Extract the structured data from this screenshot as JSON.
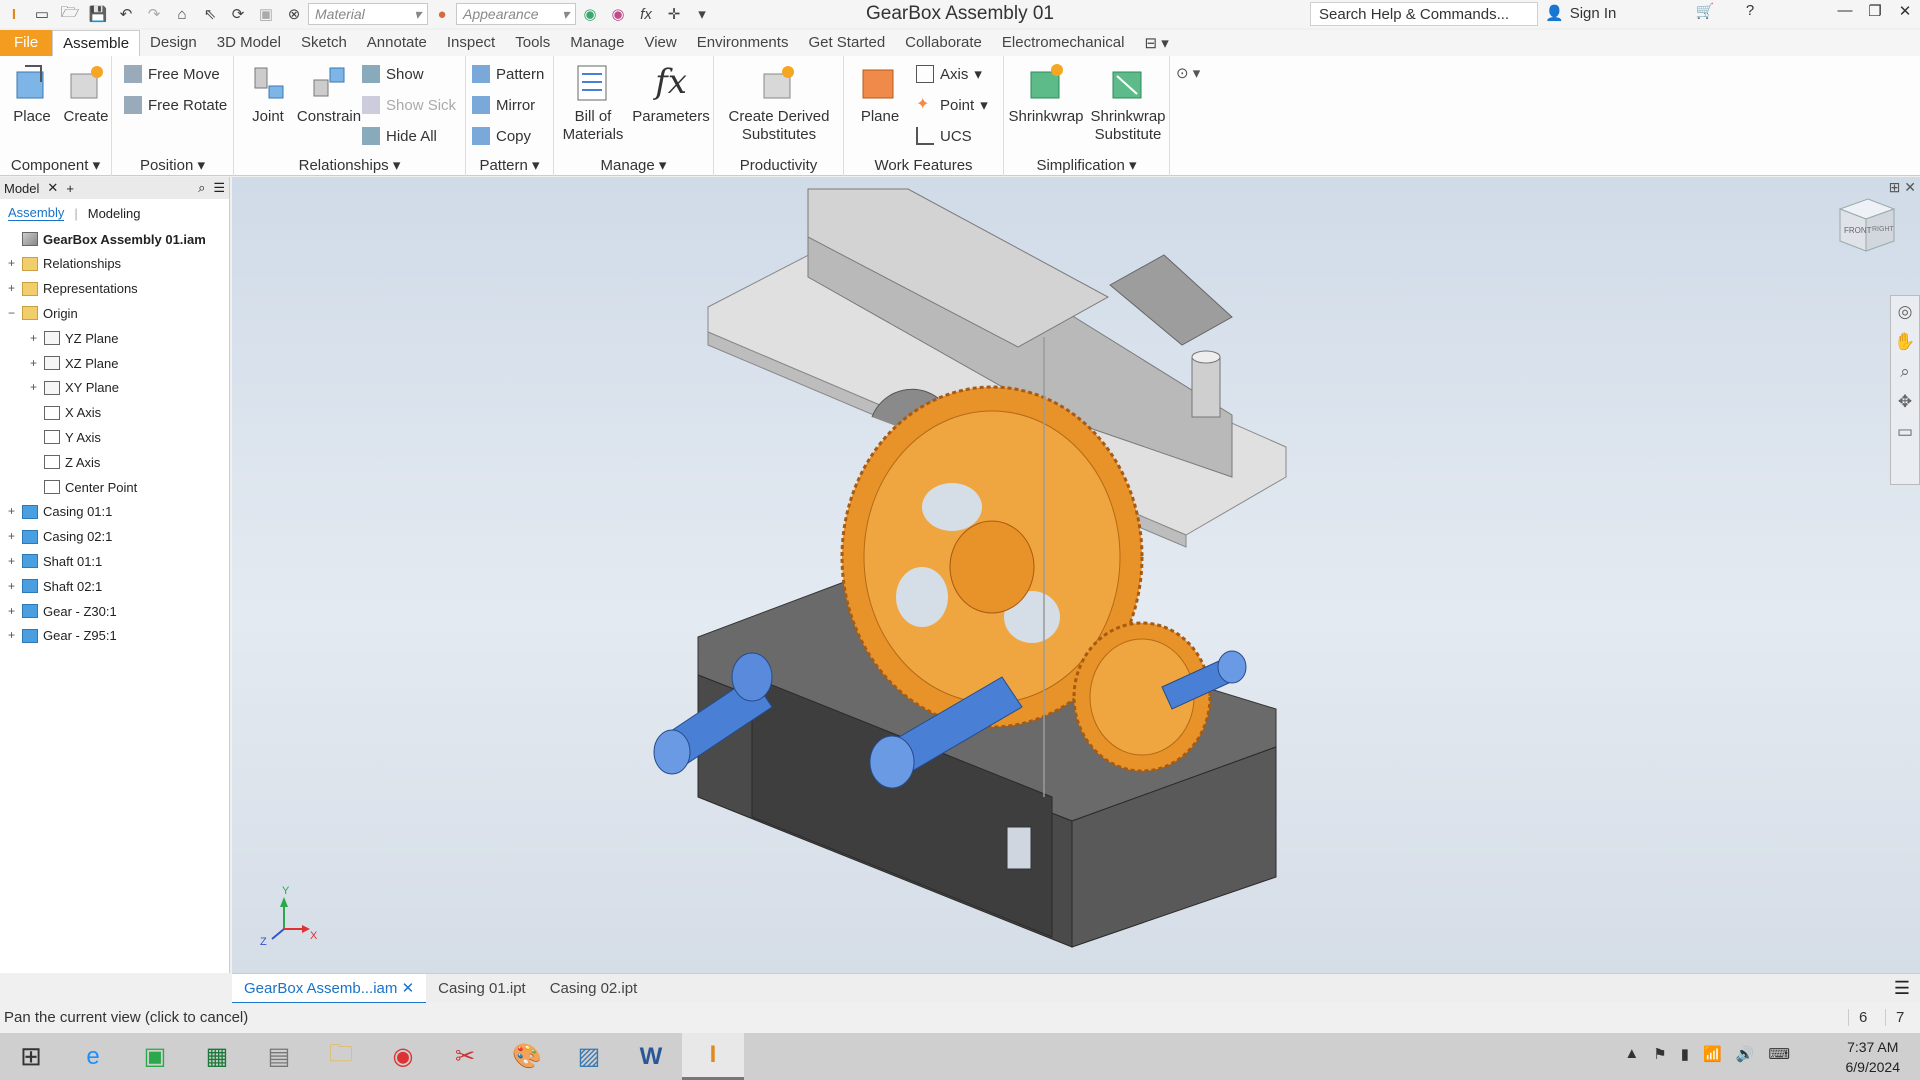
{
  "window": {
    "title": "GearBox Assembly 01",
    "material_placeholder": "Material",
    "appearance_placeholder": "Appearance",
    "search_placeholder": "Search Help & Commands...",
    "signin_label": "Sign In"
  },
  "ribbon_tabs": [
    "File",
    "Assemble",
    "Design",
    "3D Model",
    "Sketch",
    "Annotate",
    "Inspect",
    "Tools",
    "Manage",
    "View",
    "Environments",
    "Get Started",
    "Collaborate",
    "Electromechanical"
  ],
  "ribbon": {
    "component": {
      "label": "Component",
      "place": "Place",
      "create": "Create"
    },
    "position": {
      "label": "Position",
      "free_move": "Free Move",
      "free_rotate": "Free Rotate"
    },
    "relationships": {
      "label": "Relationships",
      "joint": "Joint",
      "constrain": "Constrain",
      "show": "Show",
      "show_sick": "Show Sick",
      "hide_all": "Hide All"
    },
    "pattern": {
      "label": "Pattern",
      "pattern": "Pattern",
      "mirror": "Mirror",
      "copy": "Copy"
    },
    "manage": {
      "label": "Manage",
      "bom": "Bill of\nMaterials",
      "parameters": "Parameters"
    },
    "productivity": {
      "label": "Productivity",
      "create_derived": "Create Derived\nSubstitutes"
    },
    "work_features": {
      "label": "Work Features",
      "plane": "Plane",
      "axis": "Axis",
      "point": "Point",
      "ucs": "UCS"
    },
    "simplification": {
      "label": "Simplification",
      "shrinkwrap": "Shrinkwrap",
      "shrinkwrap_sub": "Shrinkwrap\nSubstitute"
    }
  },
  "browser": {
    "title": "Model",
    "tabs": [
      "Assembly",
      "Modeling"
    ],
    "tree": [
      {
        "label": "GearBox Assembly 01.iam",
        "icon": "assembly-icon",
        "level": 0,
        "expander": ""
      },
      {
        "label": "Relationships",
        "icon": "folder-icon",
        "level": 0,
        "expander": "+"
      },
      {
        "label": "Representations",
        "icon": "folder-icon",
        "level": 0,
        "expander": "+"
      },
      {
        "label": "Origin",
        "icon": "folder-icon",
        "level": 0,
        "expander": "−"
      },
      {
        "label": "YZ Plane",
        "icon": "plane-icon",
        "level": 1,
        "expander": "+"
      },
      {
        "label": "XZ Plane",
        "icon": "plane-icon",
        "level": 1,
        "expander": "+"
      },
      {
        "label": "XY Plane",
        "icon": "plane-icon",
        "level": 1,
        "expander": "+"
      },
      {
        "label": "X Axis",
        "icon": "axis-icon",
        "level": 1,
        "expander": ""
      },
      {
        "label": "Y Axis",
        "icon": "axis-icon",
        "level": 1,
        "expander": ""
      },
      {
        "label": "Z Axis",
        "icon": "axis-icon",
        "level": 1,
        "expander": ""
      },
      {
        "label": "Center Point",
        "icon": "point-icon",
        "level": 1,
        "expander": ""
      },
      {
        "label": "Casing 01:1",
        "icon": "part-icon",
        "level": 0,
        "expander": "+"
      },
      {
        "label": "Casing 02:1",
        "icon": "part-icon",
        "level": 0,
        "expander": "+"
      },
      {
        "label": "Shaft 01:1",
        "icon": "part-icon",
        "level": 0,
        "expander": "+"
      },
      {
        "label": "Shaft 02:1",
        "icon": "part-icon",
        "level": 0,
        "expander": "+"
      },
      {
        "label": "Gear - Z30:1",
        "icon": "part-icon",
        "level": 0,
        "expander": "+"
      },
      {
        "label": "Gear - Z95:1",
        "icon": "part-icon",
        "level": 0,
        "expander": "+"
      }
    ]
  },
  "viewcube": {
    "front": "FRONT",
    "right": "RIGHT"
  },
  "axis_triad": {
    "x": "X",
    "y": "Y",
    "z": "Z"
  },
  "doc_tabs": [
    "GearBox Assemb...iam",
    "Casing 01.ipt",
    "Casing 02.ipt"
  ],
  "status": {
    "message": "Pan the current view (click to cancel)",
    "count1": "6",
    "count2": "7"
  },
  "taskbar": {
    "time": "7:37 AM",
    "date": "6/9/2024"
  },
  "colors": {
    "file_tab": "#f39c1f",
    "gear": "#e8922a",
    "shaft": "#4a7fd6",
    "casing_top": "#c8c8c8",
    "casing_bottom": "#5a5a5a"
  }
}
